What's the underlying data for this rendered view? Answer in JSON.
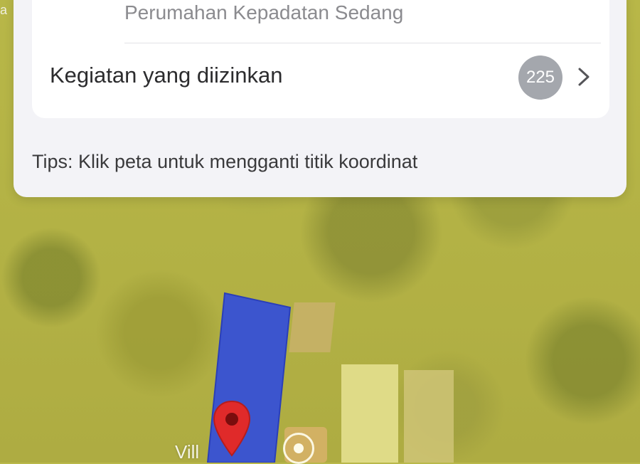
{
  "map": {
    "edge_text": "a",
    "place_label": "Vill",
    "parcel_color": "#3650d6",
    "pin_color": "#e02a2a"
  },
  "card": {
    "zone_subtitle": "Perumahan Kepadatan Sedang",
    "zone_badge_color": "#f5df3c",
    "activities_label": "Kegiatan yang diizinkan",
    "activities_count": "225",
    "tips": "Tips: Klik peta untuk mengganti titik koordinat"
  },
  "icons": {
    "chevron": "chevron-right-icon",
    "pin": "map-pin-icon",
    "location": "current-location-icon"
  }
}
